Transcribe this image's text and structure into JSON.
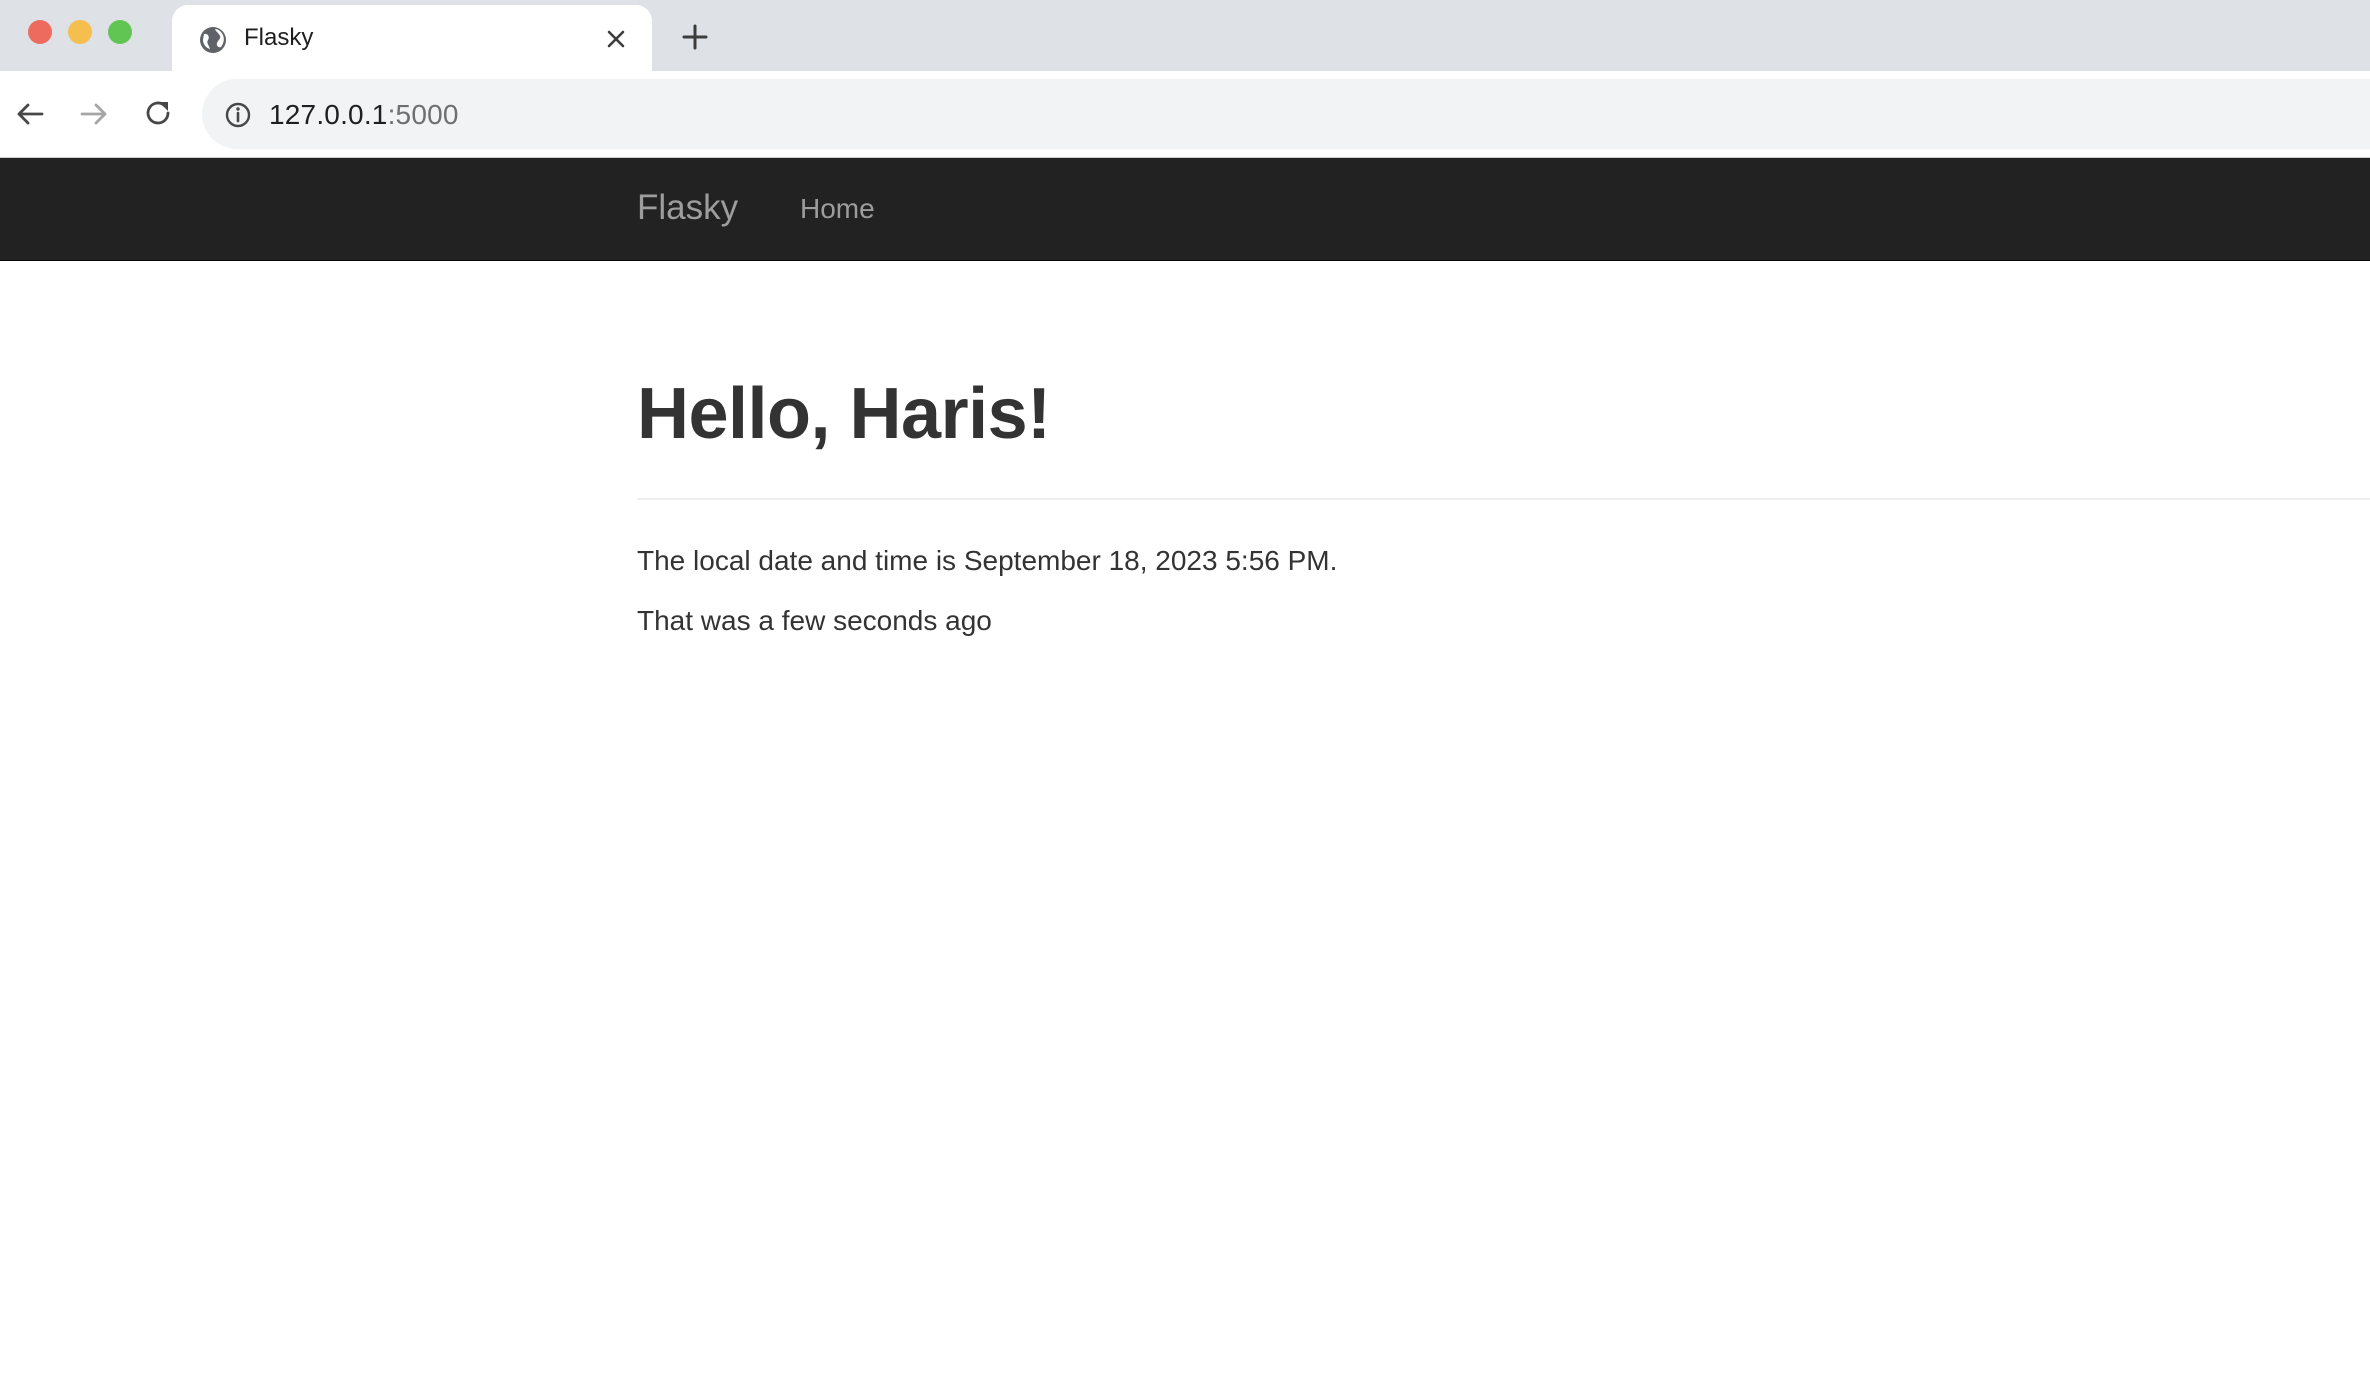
{
  "browser": {
    "tab": {
      "title": "Flasky",
      "favicon": "globe-icon"
    },
    "address": {
      "host": "127.0.0.1",
      "port": ":5000"
    },
    "icons": {
      "back": "arrow-left-icon",
      "forward": "arrow-right-icon",
      "reload": "reload-icon",
      "info": "info-icon",
      "close_tab": "close-icon",
      "new_tab": "plus-icon"
    }
  },
  "navbar": {
    "brand": "Flasky",
    "links": [
      {
        "label": "Home"
      }
    ]
  },
  "main": {
    "heading": "Hello, Haris!",
    "paragraphs": [
      "The local date and time is September 18, 2023 5:56 PM.",
      "That was a few seconds ago"
    ]
  },
  "colors": {
    "navbar_bg": "#222222",
    "navbar_text": "#9d9d9d",
    "body_text": "#333333"
  }
}
